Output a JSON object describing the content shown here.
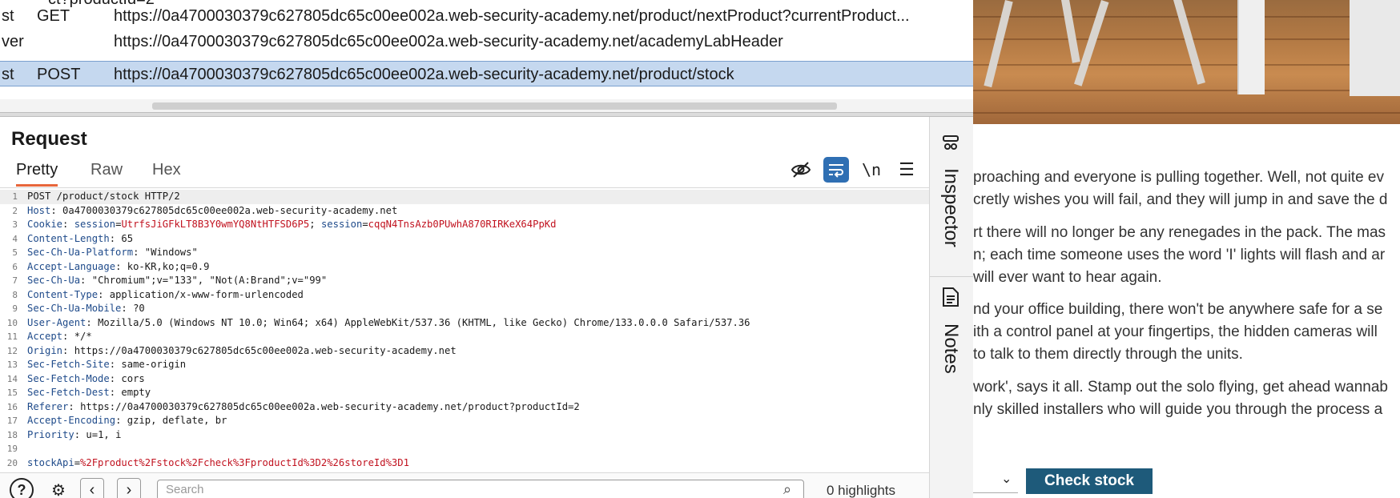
{
  "history": {
    "peek_text": "ct?productId=2",
    "rows": [
      {
        "src": "st",
        "method": "GET",
        "url": "https://0a4700030379c627805dc65c00ee002a.web-security-academy.net/product/nextProduct?currentProduct...",
        "selected": false
      },
      {
        "src": "ver",
        "method": "",
        "url": "https://0a4700030379c627805dc65c00ee002a.web-security-academy.net/academyLabHeader",
        "selected": false
      },
      {
        "src": "st",
        "method": "POST",
        "url": "https://0a4700030379c627805dc65c00ee002a.web-security-academy.net/product/stock",
        "selected": true
      }
    ]
  },
  "request": {
    "title": "Request",
    "tabs": [
      "Pretty",
      "Raw",
      "Hex"
    ],
    "active_tab": "Pretty",
    "newline_label": "\\n",
    "lines": [
      {
        "n": "1",
        "key": "",
        "sep": "",
        "value": "POST /product/stock HTTP/2"
      },
      {
        "n": "2",
        "key": "Host",
        "sep": ": ",
        "value": "0a4700030379c627805dc65c00ee002a.web-security-academy.net"
      },
      {
        "n": "3",
        "key": "Cookie",
        "sep": ": ",
        "value": "",
        "cookie": [
          {
            "k": "session",
            "v": "UtrfsJiGFkLT8B3Y0wmYQ8NtHTFSD6P5"
          },
          {
            "k": "session",
            "v": "cqqN4TnsAzb0PUwhA870RIRKeX64PpKd"
          }
        ]
      },
      {
        "n": "4",
        "key": "Content-Length",
        "sep": ": ",
        "value": "65"
      },
      {
        "n": "5",
        "key": "Sec-Ch-Ua-Platform",
        "sep": ": ",
        "value": "\"Windows\""
      },
      {
        "n": "6",
        "key": "Accept-Language",
        "sep": ": ",
        "value": "ko-KR,ko;q=0.9"
      },
      {
        "n": "7",
        "key": "Sec-Ch-Ua",
        "sep": ": ",
        "value": "\"Chromium\";v=\"133\", \"Not(A:Brand\";v=\"99\""
      },
      {
        "n": "8",
        "key": "Content-Type",
        "sep": ": ",
        "value": "application/x-www-form-urlencoded"
      },
      {
        "n": "9",
        "key": "Sec-Ch-Ua-Mobile",
        "sep": ": ",
        "value": "?0"
      },
      {
        "n": "10",
        "key": "User-Agent",
        "sep": ": ",
        "value": "Mozilla/5.0 (Windows NT 10.0; Win64; x64) AppleWebKit/537.36 (KHTML, like Gecko) Chrome/133.0.0.0 Safari/537.36"
      },
      {
        "n": "11",
        "key": "Accept",
        "sep": ": ",
        "value": "*/*"
      },
      {
        "n": "12",
        "key": "Origin",
        "sep": ": ",
        "value": "https://0a4700030379c627805dc65c00ee002a.web-security-academy.net"
      },
      {
        "n": "13",
        "key": "Sec-Fetch-Site",
        "sep": ": ",
        "value": "same-origin"
      },
      {
        "n": "14",
        "key": "Sec-Fetch-Mode",
        "sep": ": ",
        "value": "cors"
      },
      {
        "n": "15",
        "key": "Sec-Fetch-Dest",
        "sep": ": ",
        "value": "empty"
      },
      {
        "n": "16",
        "key": "Referer",
        "sep": ": ",
        "value": "https://0a4700030379c627805dc65c00ee002a.web-security-academy.net/product?productId=2"
      },
      {
        "n": "17",
        "key": "Accept-Encoding",
        "sep": ": ",
        "value": "gzip, deflate, br"
      },
      {
        "n": "18",
        "key": "Priority",
        "sep": ": ",
        "value": "u=1, i"
      },
      {
        "n": "19",
        "key": "",
        "sep": "",
        "value": ""
      },
      {
        "n": "20",
        "key": "stockApi",
        "sep": "=",
        "value": "%2Fproduct%2Fstock%2Fcheck%3FproductId%3D2%26storeId%3D1",
        "body": true
      }
    ]
  },
  "bottom": {
    "search_placeholder": "Search",
    "highlights": "0 highlights"
  },
  "sidebar": {
    "inspector_label": "Inspector",
    "notes_label": "Notes"
  },
  "browser": {
    "paragraphs": [
      "proaching and everyone is pulling together. Well, not quite ev",
      "cretly wishes you will fail, and they will jump in and save the d",
      "rt there will no longer be any renegades in the pack. The mas",
      "n; each time someone uses the word 'I' lights will flash and ar",
      "will ever want to hear again.",
      "nd your office building, there won't be anywhere safe for a se",
      "ith a control panel at your fingertips, the hidden cameras will",
      "to talk to them directly through the units.",
      "work', says it all. Stamp out the solo flying, get ahead wannab",
      "nly skilled installers who will guide you through the process a"
    ],
    "check_stock_label": "Check stock"
  },
  "colors": {
    "selected_row": "#c5d8ef",
    "header_key": "#1e4a8a",
    "cookie_value": "#c1121f",
    "tab_accent": "#e8663b",
    "wrap_button": "#2f6fb3",
    "check_stock_button": "#1e5a7a"
  }
}
